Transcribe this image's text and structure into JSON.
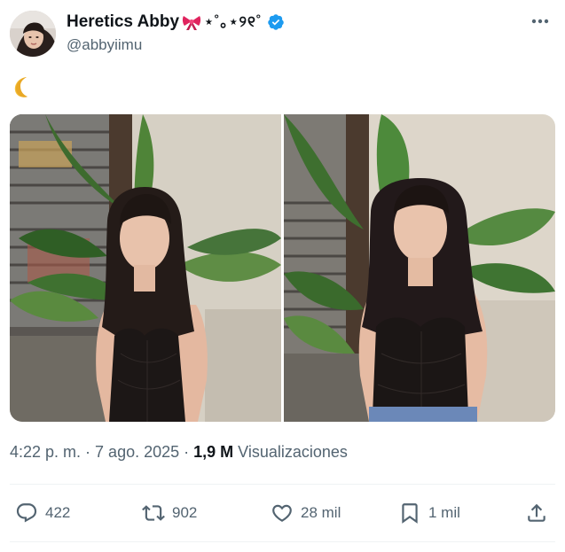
{
  "author": {
    "display_name": "Heretics Abby",
    "name_decoration": "⋆˚｡⋆୨୧˚",
    "handle": "@abbyiimu",
    "verified": true,
    "avatar_icon": "avatar-photo",
    "bow_icon": "ribbon-bow-icon"
  },
  "tweet": {
    "text": "",
    "emoji_icon": "crescent-moon-icon",
    "media_count": 2
  },
  "meta": {
    "time": "4:22 p. m.",
    "separator": " · ",
    "date": "7 ago. 2025",
    "separator2": " · ",
    "views_count": "1,9 M",
    "views_label": " Visualizaciones"
  },
  "actions": {
    "reply": {
      "icon": "reply-icon",
      "count": "422"
    },
    "retweet": {
      "icon": "retweet-icon",
      "count": "902"
    },
    "like": {
      "icon": "heart-icon",
      "count": "28 mil"
    },
    "bookmark": {
      "icon": "bookmark-icon",
      "count": "1 mil"
    },
    "share": {
      "icon": "share-icon"
    }
  },
  "colors": {
    "text": "#0f1419",
    "secondary": "#536471",
    "verified": "#1d9bf0",
    "divider": "#eff3f4"
  }
}
